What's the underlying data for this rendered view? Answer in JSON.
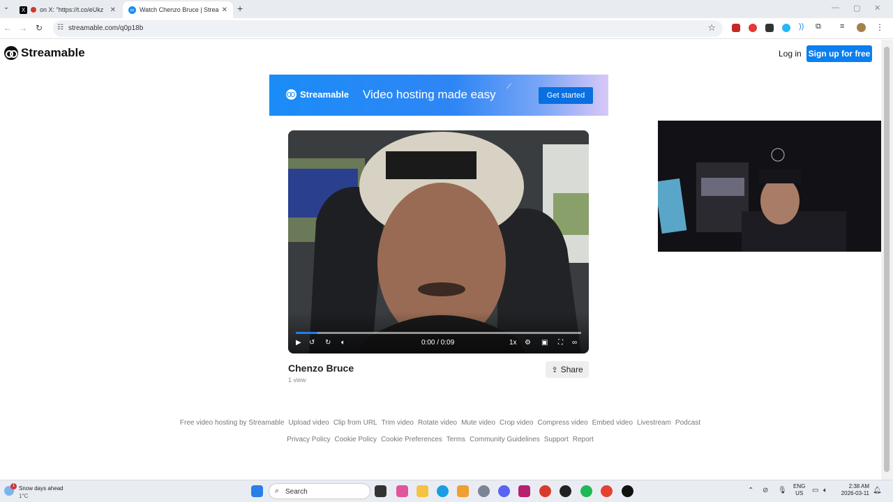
{
  "browser": {
    "tabs": [
      {
        "title": "on X: \"https://t.co/eUkz",
        "active": false
      },
      {
        "title": "Watch Chenzo Bruce | Streamab",
        "active": true
      }
    ],
    "url": "streamable.com/q0p18b"
  },
  "header": {
    "logo": "Streamable",
    "login": "Log in",
    "signup": "Sign up for free"
  },
  "promo": {
    "brand": "Streamable",
    "headline": "Video hosting made easy",
    "cta": "Get started"
  },
  "player": {
    "time": "0:00 / 0:09",
    "speed": "1x",
    "progress": 0
  },
  "video": {
    "title": "Chenzo Bruce",
    "views": "1 view",
    "share": "Share"
  },
  "footer": {
    "row1": [
      "Free video hosting by Streamable",
      "Upload video",
      "Clip from URL",
      "Trim video",
      "Rotate video",
      "Mute video",
      "Crop video",
      "Compress video",
      "Embed video",
      "Livestream",
      "Podcast"
    ],
    "row2": [
      "Privacy Policy",
      "Cookie Policy",
      "Cookie Preferences",
      "Terms",
      "Community Guidelines",
      "Support",
      "Report"
    ]
  },
  "taskbar": {
    "weather_title": "Snow days ahead",
    "weather_temp": "1°C",
    "weather_badge": "1",
    "search": "Search",
    "lang_top": "ENG",
    "lang_bottom": "US",
    "time": "2:38 AM",
    "date": "2026-03-11"
  },
  "colors": {
    "accent": "#0b7ff0",
    "promo_start": "#1a8cf7",
    "progress": "#1f7fe8"
  }
}
